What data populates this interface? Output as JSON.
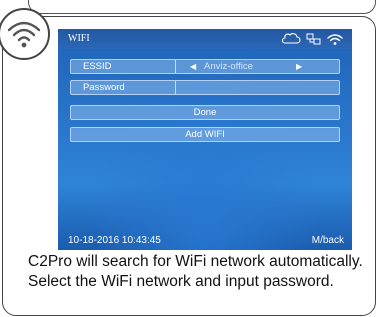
{
  "screen": {
    "title": "WIFI",
    "status_icons": [
      "cloud-icon",
      "network-icon",
      "wifi-signal-icon"
    ]
  },
  "form": {
    "essid_label": "ESSID",
    "essid_value": "Anviz-office",
    "password_label": "Password",
    "password_value": ""
  },
  "buttons": {
    "done": "Done",
    "add_wifi": "Add WIFI"
  },
  "footer": {
    "datetime": "10-18-2016 10:43:45",
    "back": "M/back"
  },
  "caption": "C2Pro will search for WiFi network automatically. Select the WiFi network and input password.",
  "colors": {
    "screen_blue": "#2a77cd",
    "text": "#111111"
  }
}
